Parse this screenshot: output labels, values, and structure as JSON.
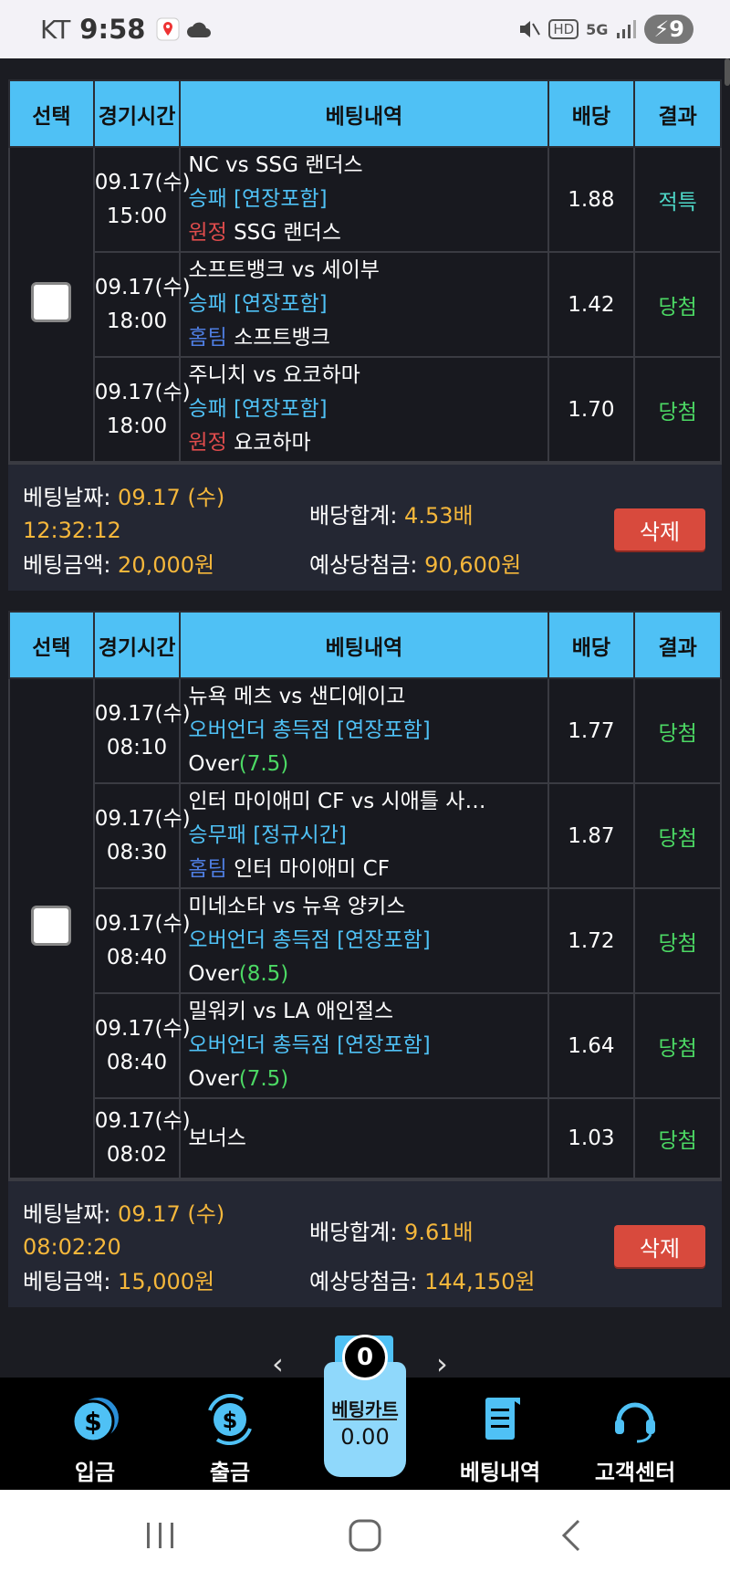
{
  "status": {
    "carrier": "KT",
    "time": "9:58",
    "battery": "9",
    "hd": "HD",
    "net": "5G"
  },
  "headers": [
    "선택",
    "경기시간",
    "베팅내역",
    "배당",
    "결과"
  ],
  "bets": [
    {
      "rows": [
        {
          "time1": "09.17(수)",
          "time2": "15:00",
          "match": "NC vs SSG 랜더스",
          "market": "승패 [연장포함]",
          "pick_tag": "원정",
          "pick_tag_type": "away",
          "pick": "SSG 랜더스",
          "pick_extra": "",
          "odds": "1.88",
          "result": "적특",
          "result_color": "#4ed8c8"
        },
        {
          "time1": "09.17(수)",
          "time2": "18:00",
          "match": "소프트뱅크 vs 세이부",
          "market": "승패 [연장포함]",
          "pick_tag": "홈팀",
          "pick_tag_type": "home",
          "pick": "소프트뱅크",
          "pick_extra": "",
          "odds": "1.42",
          "result": "당첨",
          "result_color": "#4cd964"
        },
        {
          "time1": "09.17(수)",
          "time2": "18:00",
          "match": "주니치 vs 요코하마",
          "market": "승패 [연장포함]",
          "pick_tag": "원정",
          "pick_tag_type": "away",
          "pick": "요코하마",
          "pick_extra": "",
          "odds": "1.70",
          "result": "당첨",
          "result_color": "#4cd964"
        }
      ],
      "summary": {
        "date_label": "베팅날짜:",
        "date": "09.17 (수)",
        "time": "12:32:12",
        "amount_label": "베팅금액:",
        "amount": "20,000원",
        "total_odds_label": "배당합계:",
        "total_odds": "4.53배",
        "expected_label": "예상당첨금:",
        "expected": "90,600원",
        "delete": "삭제"
      }
    },
    {
      "rows": [
        {
          "time1": "09.17(수)",
          "time2": "08:10",
          "match": "뉴욕 메츠 vs 샌디에이고",
          "market": "오버언더 총득점 [연장포함]",
          "pick_tag": "",
          "pick_tag_type": "",
          "pick": "Over",
          "pick_extra": "(7.5)",
          "odds": "1.77",
          "result": "당첨",
          "result_color": "#4cd964"
        },
        {
          "time1": "09.17(수)",
          "time2": "08:30",
          "match": "인터 마이애미 CF vs 시애틀 사…",
          "market": "승무패 [정규시간]",
          "pick_tag": "홈팀",
          "pick_tag_type": "home",
          "pick": "인터 마이애미 CF",
          "pick_extra": "",
          "odds": "1.87",
          "result": "당첨",
          "result_color": "#4cd964"
        },
        {
          "time1": "09.17(수)",
          "time2": "08:40",
          "match": "미네소타 vs 뉴욕 양키스",
          "market": "오버언더 총득점 [연장포함]",
          "pick_tag": "",
          "pick_tag_type": "",
          "pick": "Over",
          "pick_extra": "(8.5)",
          "odds": "1.72",
          "result": "당첨",
          "result_color": "#4cd964"
        },
        {
          "time1": "09.17(수)",
          "time2": "08:40",
          "match": "밀워키 vs LA 애인절스",
          "market": "오버언더 총득점 [연장포함]",
          "pick_tag": "",
          "pick_tag_type": "",
          "pick": "Over",
          "pick_extra": "(7.5)",
          "odds": "1.64",
          "result": "당첨",
          "result_color": "#4cd964"
        },
        {
          "time1": "09.17(수)",
          "time2": "08:02",
          "match": "보너스",
          "market": "",
          "pick_tag": "",
          "pick_tag_type": "",
          "pick": "",
          "pick_extra": "",
          "odds": "1.03",
          "result": "당첨",
          "result_color": "#4cd964"
        }
      ],
      "summary": {
        "date_label": "베팅날짜:",
        "date": "09.17 (수)",
        "time": "08:02:20",
        "amount_label": "베팅금액:",
        "amount": "15,000원",
        "total_odds_label": "배당합계:",
        "total_odds": "9.61배",
        "expected_label": "예상당첨금:",
        "expected": "144,150원",
        "delete": "삭제"
      }
    }
  ],
  "pager": {
    "prev": "‹",
    "next": "›"
  },
  "nav": {
    "deposit": "입금",
    "withdraw": "출금",
    "history": "베팅내역",
    "support": "고객센터"
  },
  "cart": {
    "count": "0",
    "label": "베팅카트",
    "value": "0.00"
  },
  "colors": {
    "header": "#4fc1f5",
    "accent_yellow": "#f5b73b",
    "win_green": "#4cd964",
    "delete_red": "#d84a3d"
  }
}
